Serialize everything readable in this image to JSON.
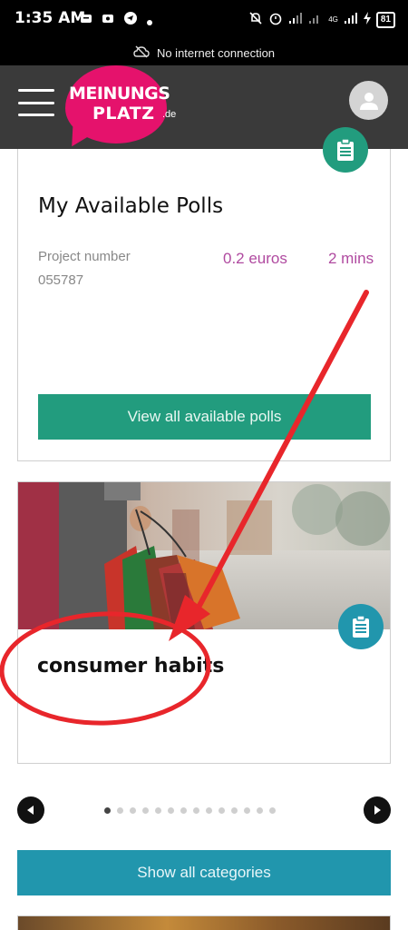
{
  "status_bar": {
    "time": "1:35 AM",
    "battery": "81",
    "network": "4G"
  },
  "connection_banner": {
    "text": "No internet connection",
    "icon": "cloud-off-icon"
  },
  "header": {
    "logo_line1": "MEINUNGS",
    "logo_line2": "PLATZ",
    "logo_suffix": ".de",
    "menu_icon": "hamburger-menu-icon",
    "profile_icon": "user-avatar-icon",
    "logo_color": "#e5126c",
    "background": "#3a3a3a"
  },
  "polls_card": {
    "title": "My Available Polls",
    "project_label": "Project number",
    "project_number": "055787",
    "reward": "0.2 euros",
    "duration": "2 mins",
    "button_label": "View all available polls",
    "badge_icon": "clipboard-icon",
    "accent_color": "#229c7e",
    "value_color": "#b04aa0"
  },
  "category_card": {
    "title": "consumer habits",
    "image": "shopping-bags-photo",
    "badge_icon": "clipboard-icon",
    "accent_color": "#2196ad"
  },
  "pager": {
    "prev_icon": "arrow-left-icon",
    "next_icon": "arrow-right-icon",
    "page_count": 14,
    "active_page": 1
  },
  "categories_button": {
    "label": "Show all categories",
    "color": "#2196ad"
  },
  "annotation": {
    "color": "#e8262b",
    "type": "red-arrow-and-circle"
  }
}
